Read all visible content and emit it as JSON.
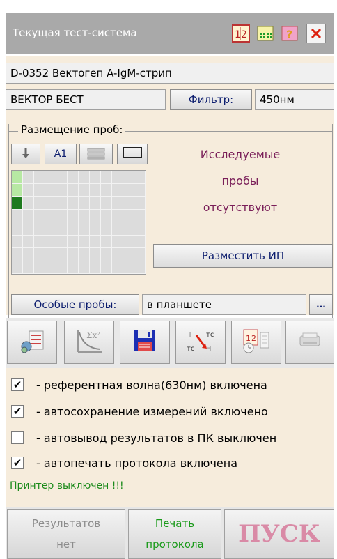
{
  "window": {
    "title": "Текущая тест-система",
    "icons": [
      "calendar-grid-icon",
      "plate-icon",
      "help-icon",
      "close-icon"
    ]
  },
  "test": {
    "name": "D-0352 Вектогеп A-IgM-стрип",
    "kit": "ВЕКТОР БЕСТ",
    "filter_label": "Фильтр:",
    "filter_value": "450нм"
  },
  "placement": {
    "legend": "Размещение проб:",
    "tool_a1": "A1",
    "message_lines": [
      "Исследуемые",
      "пробы",
      "отсутствуют"
    ],
    "place_button": "Разместить ИП",
    "special_label": "Особые пробы:",
    "special_value": "в планшете",
    "more_button": "..."
  },
  "toolbar": {
    "buttons": [
      "list-config-icon",
      "calibration-curve-icon",
      "save-disk-icon",
      "conversion-icon",
      "timer-icon",
      "printer-icon"
    ]
  },
  "options": [
    {
      "checked": true,
      "label": "- референтная волна(630нм) включена"
    },
    {
      "checked": true,
      "label": "- автосохранение измерений включено"
    },
    {
      "checked": false,
      "label": "- автовывод результатов в ПК выключен"
    },
    {
      "checked": true,
      "label": "- автопечать протокола включена"
    }
  ],
  "printer_status": "Принтер выключен !!!",
  "bottom": {
    "results_line1": "Результатов",
    "results_line2": "нет",
    "print_line1": "Печать",
    "print_line2": "протокола",
    "start": "ПУСК"
  },
  "colors": {
    "title_bg": "#a9a9a9",
    "form_bg": "#f6ecdc",
    "message": "#7a1f59",
    "printer_status": "#1a8a1a",
    "start": "#d98aa6",
    "plate_filled": "#1e7a1e",
    "plate_light": "#b7e8a3"
  }
}
